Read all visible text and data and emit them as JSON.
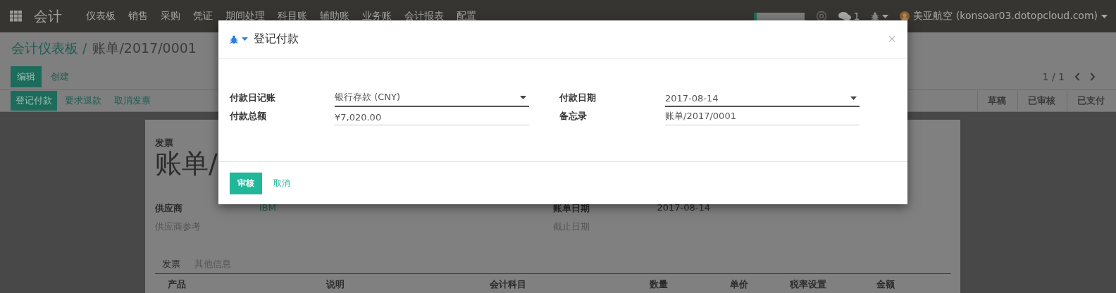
{
  "navbar": {
    "app_name": "会计",
    "menus": [
      "仪表板",
      "销售",
      "采购",
      "凭证",
      "期间处理",
      "科目账",
      "辅助账",
      "业务账",
      "会计报表",
      "配置"
    ],
    "chat_count": "1",
    "user": "美亚航空 (konsoar03.dotopcloud.com)"
  },
  "breadcrumb": {
    "parent": "会计仪表板 /",
    "current": "账单/2017/0001"
  },
  "buttons": [
    {
      "label": "编辑",
      "kind": "primary"
    },
    {
      "label": "创建",
      "kind": "link"
    }
  ],
  "pager": "1 / 1",
  "header_buttons": [
    {
      "label": "登记付款",
      "kind": "primary"
    },
    {
      "label": "要求退款",
      "kind": "link"
    },
    {
      "label": "取消发票",
      "kind": "link"
    }
  ],
  "stages": [
    "草稿",
    "已审核",
    "已支付"
  ],
  "sheet": {
    "subtitle": "发票",
    "title": "账单/",
    "left_fields": [
      {
        "label": "供应商",
        "value": "IBM",
        "kind": "link"
      },
      {
        "label": "供应商参考",
        "kind": "empty"
      }
    ],
    "right_fields": [
      {
        "label": "账单日期",
        "value": "2017-08-14",
        "kind": "text"
      },
      {
        "label": "截止日期",
        "kind": "empty"
      }
    ],
    "tabs": [
      {
        "label": "发票",
        "selected": true
      },
      {
        "label": "其他信息",
        "selected": false
      }
    ],
    "columns": [
      "产品",
      "说明",
      "会计科目",
      "数量",
      "单价",
      "税率设置",
      "金额"
    ]
  },
  "dialog": {
    "title": "登记付款",
    "fields": [
      {
        "label": "付款日记账",
        "value": "银行存款 (CNY)",
        "kind": "select"
      },
      {
        "label": "付款日期",
        "value": "2017-08-14",
        "kind": "select"
      },
      {
        "label": "付款总额",
        "value": "¥7,020.00",
        "kind": "text"
      },
      {
        "label": "备忘录",
        "value": "账单/2017/0001",
        "kind": "text"
      }
    ],
    "close": "×",
    "confirm": "审核",
    "cancel": "取消"
  }
}
